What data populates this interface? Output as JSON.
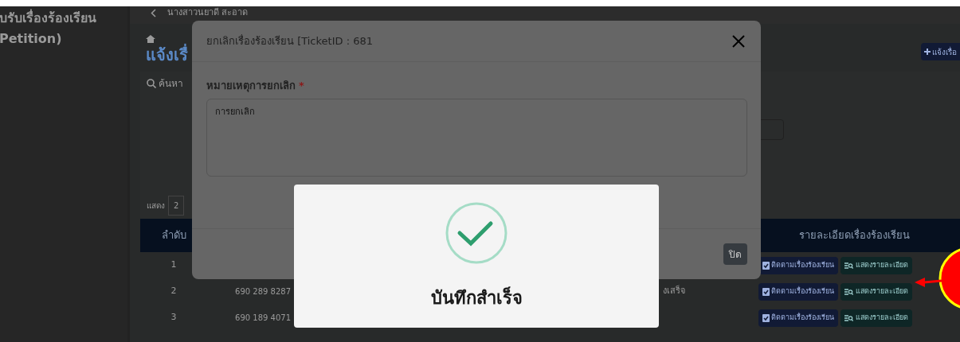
{
  "sidebar": {
    "title_lines": [
      "บรับเรื่องร้องเรียน",
      "Petition)"
    ]
  },
  "header": {
    "user": "นางสาวนยาดี สะอาด"
  },
  "page": {
    "title": "แจ้งเรื่",
    "add_button": "แจ้งเรื่อ",
    "search_label": "ค้นหา",
    "show_label": "แสดง",
    "page_size": "2"
  },
  "table": {
    "columns": [
      "ลำดับ",
      "รายละเอียดเรื่องร้องเรียน"
    ],
    "rows": [
      {
        "no": "1",
        "actions": [
          "ติดตามเรื่องร้องเรียน",
          "แสดงรายละเอียด"
        ]
      },
      {
        "no": "2",
        "ticket": "690 289 8287",
        "status": "งเสร็จ",
        "actions": [
          "ติดตามเรื่องร้องเรียน",
          "แสดงรายละเอียด"
        ]
      },
      {
        "no": "3",
        "ticket": "690 189 4071",
        "actions": [
          "ติดตามเรื่องร้องเรียน",
          "แสดงรายละเอียด"
        ]
      }
    ]
  },
  "modal": {
    "title": "ยกเลิกเรื่องร้องเรียน [TicketID : 681",
    "field_label": "หมายเหตุการยกเลิก",
    "required_mark": "*",
    "field_value": "การยกเลิก",
    "close_button": "ปิด"
  },
  "alert": {
    "kind": "success",
    "message": "บันทึกสำเร็จ"
  }
}
